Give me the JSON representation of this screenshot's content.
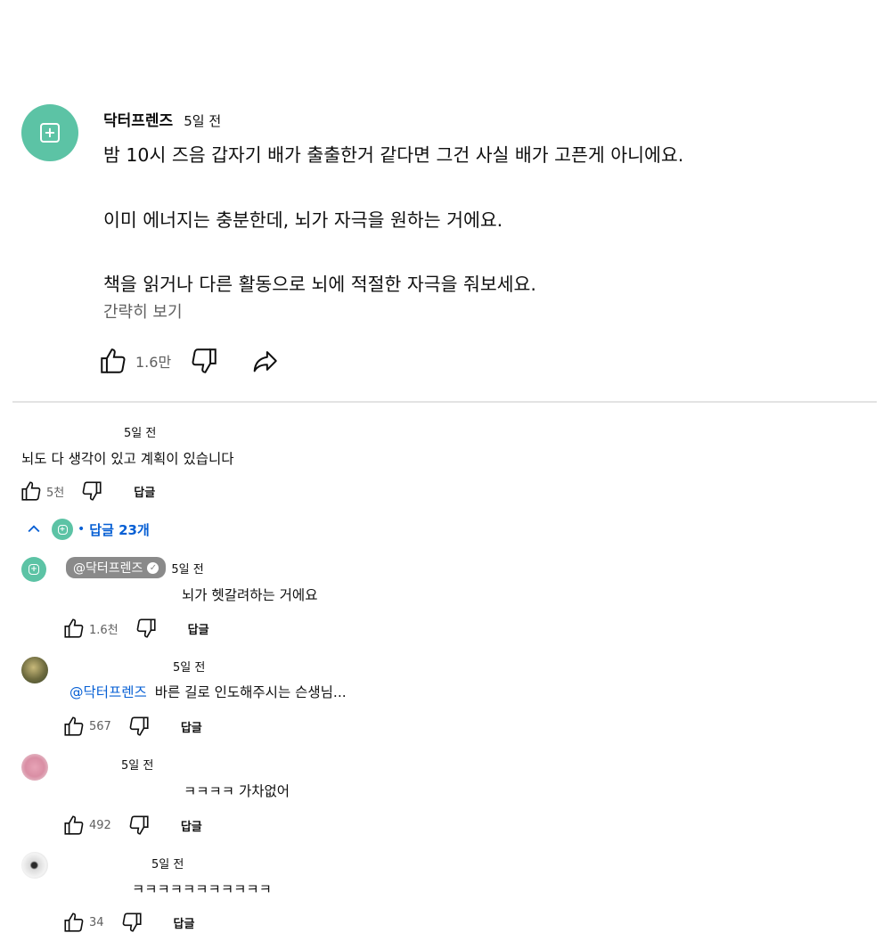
{
  "main_comment": {
    "author": "닥터프렌즈",
    "time": "5일 전",
    "lines": [
      "밤 10시 즈음 갑자기 배가 출출한거 같다면 그건 사실 배가 고픈게 아니에요.",
      "이미 에너지는 충분한데, 뇌가 자극을 원하는 거에요.",
      "책을 읽거나 다른 활동으로 뇌에 적절한 자극을 줘보세요."
    ],
    "collapse_label": "간략히 보기",
    "likes": "1.6만"
  },
  "second_comment": {
    "time": "5일 전",
    "text": "뇌도 다 생각이 있고 계획이 있습니다",
    "likes": "5천",
    "reply_label": "답글",
    "replies_toggle": "답글 23개"
  },
  "replies": [
    {
      "author": "@닥터프렌즈",
      "time": "5일 전",
      "text": "뇌가 헷갈려하는 거에요",
      "likes": "1.6천",
      "reply_label": "답글"
    },
    {
      "time": "5일 전",
      "mention": "@닥터프렌즈",
      "text": "바른 길로 인도해주시는 슨생님...",
      "likes": "567",
      "reply_label": "답글"
    },
    {
      "time": "5일 전",
      "text": "ㅋㅋㅋㅋ 가차없어",
      "likes": "492",
      "reply_label": "답글"
    },
    {
      "time": "5일 전",
      "text": "ㅋㅋㅋㅋㅋㅋㅋㅋㅋㅋㅋ",
      "likes": "34",
      "reply_label": "답글"
    }
  ],
  "colors": {
    "brand_avatar": "#5cc3a5",
    "link": "#065fd4",
    "badge": "#8a8a8a"
  }
}
